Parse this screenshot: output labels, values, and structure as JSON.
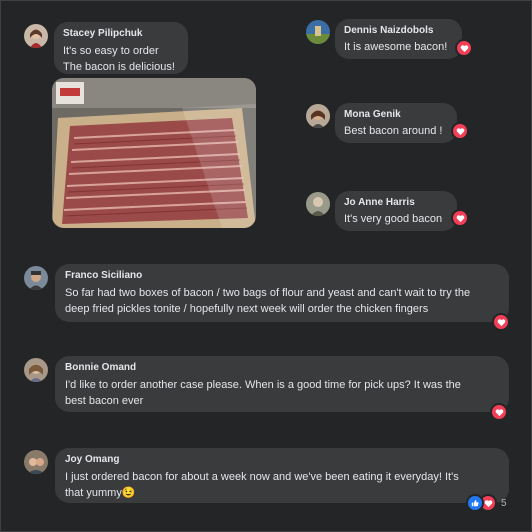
{
  "comments": {
    "stacey": {
      "name": "Stacey Pilipchuk",
      "line1": "It's so easy to order",
      "line2": "The bacon is delicious!"
    },
    "dennis": {
      "name": "Dennis Naizdobols",
      "text": "It is awesome bacon!"
    },
    "mona": {
      "name": "Mona Genik",
      "text": "Best bacon around !"
    },
    "joanne": {
      "name": "Jo Anne Harris",
      "text": "It's very good bacon"
    },
    "franco": {
      "name": "Franco Siciliano",
      "line1": "So far had two boxes of bacon / two bags of flour and yeast and can't wait to try the",
      "line2": "deep fried pickles tonite / hopefully next week will order the chicken fingers"
    },
    "bonnie": {
      "name": "Bonnie Omand",
      "line1": "I'd like to order another case please. When is a good time for pick ups? It was the",
      "line2": "best bacon ever"
    },
    "joy": {
      "name": "Joy Omang",
      "line1": "I just ordered bacon for about a week now and we've been eating it everyday! It's",
      "line2": "that yummy😉",
      "reaction_count": "5"
    }
  },
  "icons": {
    "reaction_heart": "heart-icon",
    "reaction_like": "like-icon"
  },
  "colors": {
    "background": "#242526",
    "bubble": "#3a3b3c",
    "heart": "#f33e58",
    "like": "#2078f4"
  }
}
